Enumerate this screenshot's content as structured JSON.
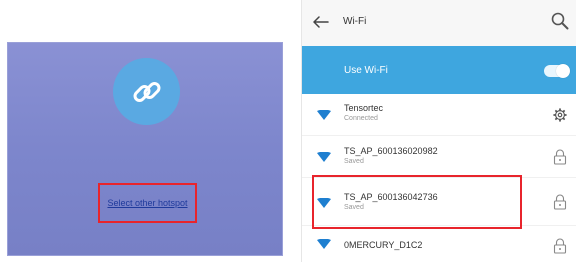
{
  "left": {
    "link_icon": "link-icon",
    "select_hotspot": "Select other hotspot"
  },
  "header": {
    "title": "Wi-Fi",
    "back_icon": "back-arrow-icon",
    "search_icon": "search-icon"
  },
  "use_wifi": {
    "label": "Use Wi-Fi",
    "enabled": true
  },
  "networks": [
    {
      "name": "Tensortec",
      "status": "Connected",
      "right_icon": "gear-icon"
    },
    {
      "name": "TS_AP_600136020982",
      "status": "Saved",
      "right_icon": "lock-icon"
    },
    {
      "name": "TS_AP_600136042736",
      "status": "Saved",
      "right_icon": "lock-icon"
    },
    {
      "name": "0MERCURY_D1C2",
      "status": "",
      "right_icon": "lock-icon"
    }
  ],
  "colors": {
    "accent": "#3ea6df",
    "highlight": "#e8242c",
    "left_panel_bg": "#7d86cc",
    "link_circle": "#5aa9e2"
  }
}
